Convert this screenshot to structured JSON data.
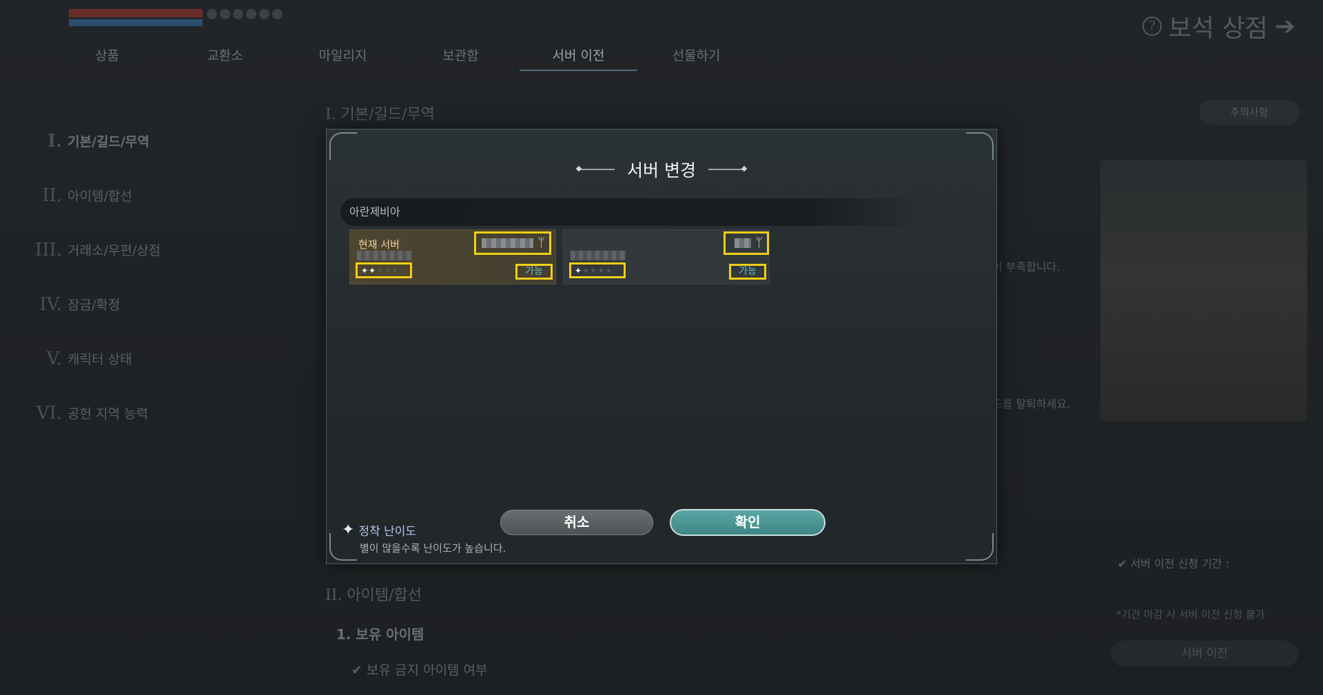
{
  "background": {
    "shop_title": "보석 상점",
    "tabs": [
      "상품",
      "교환소",
      "마일리지",
      "보관함",
      "서버 이전",
      "선물하기"
    ],
    "active_tab_index": 4,
    "side_nav": [
      {
        "num": "I.",
        "label": "기본/길드/무역"
      },
      {
        "num": "II.",
        "label": "아이템/합선"
      },
      {
        "num": "III.",
        "label": "거래소/우편/상점"
      },
      {
        "num": "IV.",
        "label": "잠금/확정"
      },
      {
        "num": "V.",
        "label": "캐릭터 상태"
      },
      {
        "num": "VI.",
        "label": "공헌 지역 능력"
      }
    ],
    "section_title": "I. 기본/길드/무역",
    "section_title2": "II. 아이템/합선",
    "sub_title": "1. 보유 아이템",
    "sub_check": "✔  보유 금지 아이템 여부",
    "hint1": "이 부족합니다.",
    "hint2": "드를 탈퇴하세요.",
    "caution_button": "주의사항",
    "right_label": "✔  서버 이전 신청 기간 :",
    "right_note": "*기간 마감 시 서버 이전 신청 불가",
    "right_button": "서버 이전"
  },
  "modal": {
    "title": "서버 변경",
    "region": "아란제비아",
    "cards": [
      {
        "label": "현재 서버",
        "stars_filled": 2,
        "stars_total": 5,
        "status": "가능",
        "current": true
      },
      {
        "label": "",
        "stars_filled": 1,
        "stars_total": 5,
        "status": "가능",
        "current": false
      }
    ],
    "cancel_label": "취소",
    "confirm_label": "확인",
    "legend_title": "정착 난이도",
    "legend_desc": "별이 많을수록 난이도가 높습니다."
  }
}
